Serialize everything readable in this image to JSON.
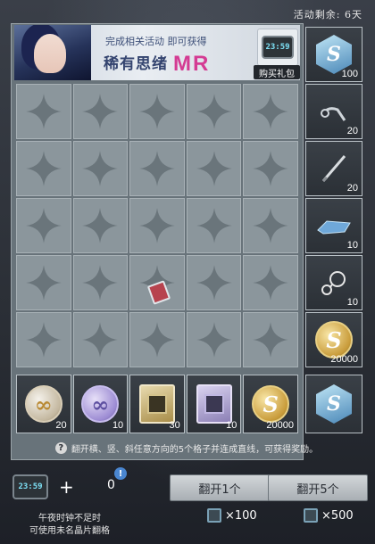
{
  "event": {
    "time_left": "活动剩余: 6天"
  },
  "banner": {
    "line1": "完成相关活动 即可获得",
    "title": "稀有思绪",
    "rarity": "MR",
    "item_time": "23:59",
    "buy_label": "购买礼包"
  },
  "grid": {
    "rows": 5,
    "cols": 5,
    "revealed_cell": "3-2"
  },
  "bottom_rewards": [
    {
      "icon": "silver-thought-coin-icon",
      "count": "20"
    },
    {
      "icon": "purple-thought-coin-icon",
      "count": "10"
    },
    {
      "icon": "gold-chip-card-icon",
      "count": "30"
    },
    {
      "icon": "violet-chip-card-icon",
      "count": "10"
    },
    {
      "icon": "gold-coin-icon",
      "count": "20000"
    }
  ],
  "side_rewards": [
    {
      "icon": "blue-crystal-icon",
      "count": "100"
    },
    {
      "icon": "earbud-icon",
      "count": "20"
    },
    {
      "icon": "pen-icon",
      "count": "20"
    },
    {
      "icon": "crystal-shard-icon",
      "count": "10"
    },
    {
      "icon": "ring-necklace-icon",
      "count": "10"
    },
    {
      "icon": "gold-coin-icon",
      "count": "20000"
    }
  ],
  "corner_reward": {
    "icon": "blue-crystal-icon"
  },
  "info": "翻开横、竖、斜任意方向的5个格子并连成直线，可获得奖励。",
  "footer": {
    "clock_time": "23:59",
    "plus": "+",
    "count": "0",
    "badge": "!",
    "note_line1": "午夜时钟不足时",
    "note_line2": "可使用未名晶片翻格",
    "flip_one_label": "翻开1个",
    "flip_five_label": "翻开5个",
    "cost_one": "×100",
    "cost_five": "×500"
  }
}
